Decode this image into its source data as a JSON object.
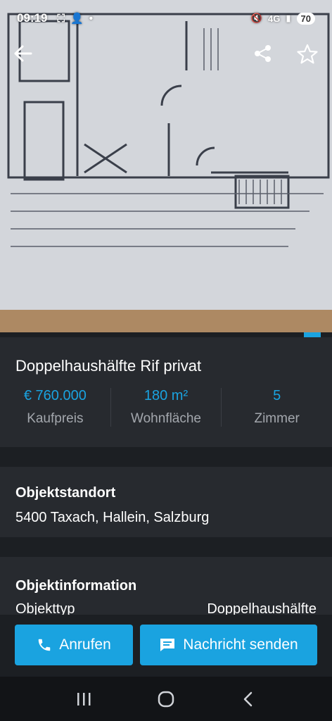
{
  "status_bar": {
    "time": "09:19",
    "network": "4G",
    "battery": "70"
  },
  "listing": {
    "title": "Doppelhaushälfte Rif privat",
    "stats": [
      {
        "value": "€ 760.000",
        "label": "Kaufpreis"
      },
      {
        "value": "180 m²",
        "label": "Wohnfläche"
      },
      {
        "value": "5",
        "label": "Zimmer"
      }
    ]
  },
  "location": {
    "heading": "Objektstandort",
    "address": "5400 Taxach, Hallein, Salzburg"
  },
  "info": {
    "heading": "Objektinformation",
    "rows": [
      {
        "key": "Objekttyp",
        "value": "Doppelhaushälfte"
      }
    ]
  },
  "actions": {
    "call_label": "Anrufen",
    "message_label": "Nachricht senden"
  },
  "colors": {
    "accent": "#1aa3e0",
    "background": "#1c1f23",
    "card": "#272a2f"
  },
  "icons": {
    "back": "arrow-left-icon",
    "share": "share-icon",
    "favorite": "star-icon",
    "phone": "phone-icon",
    "message": "message-icon",
    "nav_recent": "recent-apps-icon",
    "nav_home": "home-icon",
    "nav_back": "nav-back-icon"
  }
}
